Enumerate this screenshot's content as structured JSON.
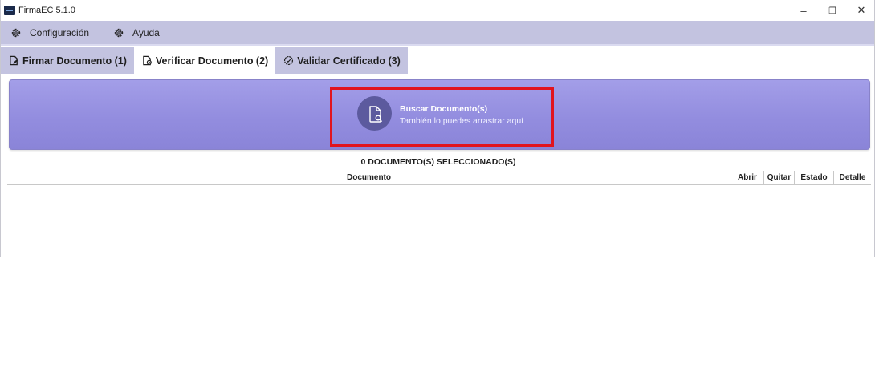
{
  "window": {
    "title": "FirmaEC 5.1.0",
    "controls": {
      "minimize": "–",
      "restore": "❐",
      "close": "✕"
    }
  },
  "menu": {
    "items": [
      {
        "label": "Configuración",
        "icon": "gear-icon"
      },
      {
        "label": "Ayuda",
        "icon": "help-gear-icon"
      }
    ]
  },
  "tabs": [
    {
      "label": "Firmar Documento (1)",
      "icon": "sign-document-icon",
      "active": false
    },
    {
      "label": "Verificar Documento (2)",
      "icon": "verify-document-icon",
      "active": true
    },
    {
      "label": "Validar Certificado (3)",
      "icon": "validate-certificate-icon",
      "active": false
    }
  ],
  "dropzone": {
    "title": "Buscar Documento(s)",
    "subtitle": "También lo puedes arrastrar aquí",
    "icon": "document-search-icon"
  },
  "documents": {
    "count_label": "0 DOCUMENTO(S) SELECCIONADO(S)",
    "columns": [
      "Documento",
      "Abrir",
      "Quitar",
      "Estado",
      "Detalle"
    ],
    "rows": []
  },
  "colors": {
    "menubar": "#c3c3e0",
    "dropzone": "#938ddf",
    "highlight": "#e1141e",
    "icon_circle": "#5c5a9e"
  }
}
